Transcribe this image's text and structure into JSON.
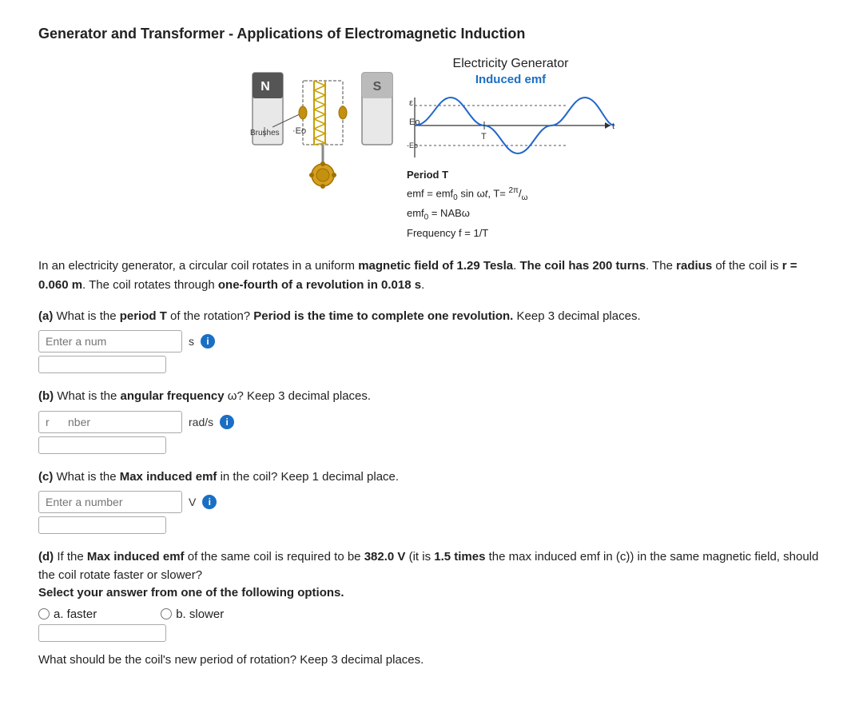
{
  "page": {
    "title": "Generator and Transformer - Applications of Electromagnetic Induction",
    "diagram": {
      "title": "Electricity Generator",
      "induced_emf_label": "Induced emf",
      "formulas": [
        "Period T",
        "emf = emf₀ sin ωt,  T= 2π/ω",
        "emf₀ = NABω",
        "Frequency f = 1/T"
      ]
    },
    "problem_text": "In an electricity generator,  a circular coil rotates in a uniform magnetic field of 1.29 Tesla. The coil has 200 turns. The radius of the coil is r = 0.060 m. The coil rotates through one-fourth of a revolution in 0.018 s.",
    "questions": [
      {
        "id": "a",
        "label": "(a) What is the period T of the rotation? Period is the time to complete one revolution. Keep 3 decimal places.",
        "input_placeholder": "Enter a num",
        "unit": "s",
        "show_info": true
      },
      {
        "id": "b",
        "label": "(b) What is the angular frequency ω? Keep 3 decimal places.",
        "input_placeholder": "r      nber",
        "unit": "rad/s",
        "show_info": true
      },
      {
        "id": "c",
        "label": "(c) What is the Max induced emf in the coil?  Keep 1 decimal place.",
        "input_placeholder": "Enter a number",
        "unit": "V",
        "show_info": true
      },
      {
        "id": "d",
        "label": "(d) If the Max induced emf of the same coil is required to be 382.0 V (it is 1.5 times the max induced emf in (c)) in the same magnetic field, should the coil rotate faster or slower?",
        "sub_label": "Select your answer from one of the following options.",
        "options": [
          {
            "id": "faster",
            "label": "a. faster"
          },
          {
            "id": "slower",
            "label": "b. slower"
          }
        ],
        "new_period_label": "What should be the coil's new period of rotation? Keep 3 decimal places."
      }
    ],
    "info_icon_label": "i"
  }
}
